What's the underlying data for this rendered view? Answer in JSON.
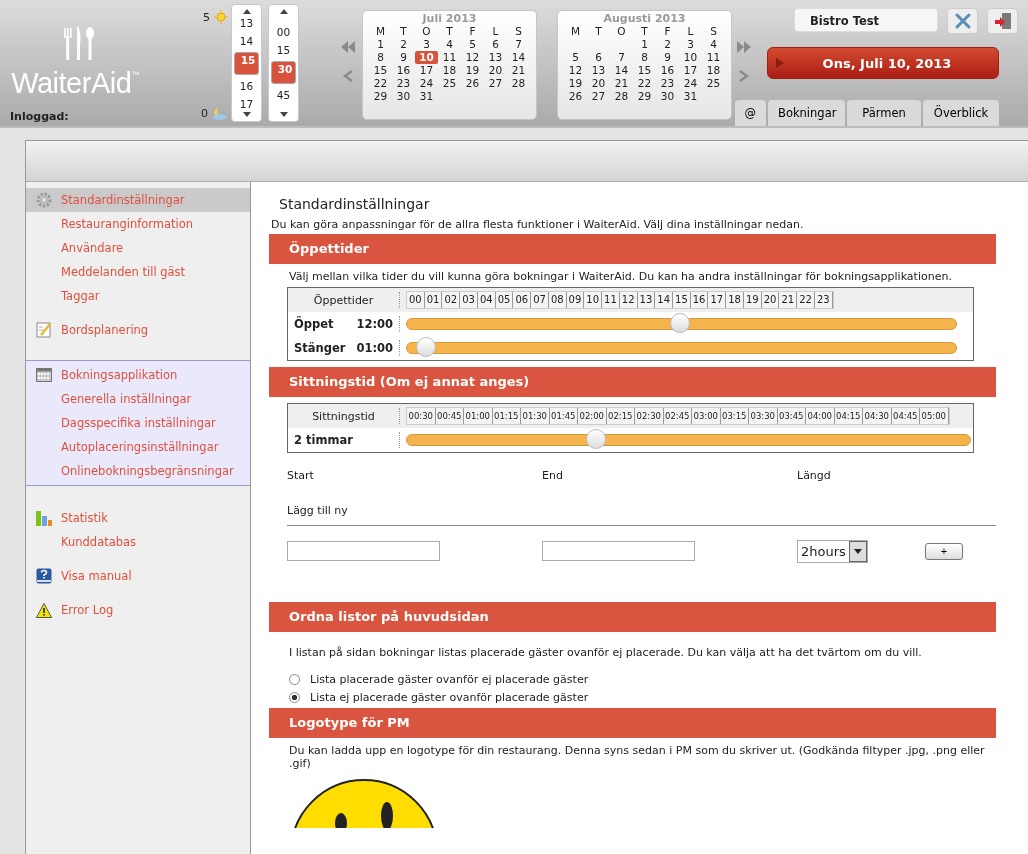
{
  "header": {
    "logo": "WaiterAid",
    "trademark": "™",
    "logged_in_label": "Inloggad:",
    "sun_count": "5",
    "moon_count": "0"
  },
  "hour_picker": [
    {
      "label": "13",
      "selected": false
    },
    {
      "label": "14",
      "selected": false
    },
    {
      "label": "15",
      "selected": true
    },
    {
      "label": "16",
      "selected": false
    },
    {
      "label": "17",
      "selected": false
    }
  ],
  "minute_picker": [
    {
      "label": "00",
      "selected": false
    },
    {
      "label": "15",
      "selected": false
    },
    {
      "label": "30",
      "selected": true
    },
    {
      "label": "45",
      "selected": false
    }
  ],
  "calendars": [
    {
      "title": "Juli 2013",
      "weekdays": [
        "M",
        "T",
        "O",
        "T",
        "F",
        "L",
        "S"
      ],
      "weeks": [
        [
          {
            "d": "1",
            "selected": false
          },
          {
            "d": "2",
            "selected": false
          },
          {
            "d": "3",
            "selected": false
          },
          {
            "d": "4",
            "selected": false
          },
          {
            "d": "5",
            "selected": false
          },
          {
            "d": "6",
            "selected": false
          },
          {
            "d": "7",
            "selected": false
          }
        ],
        [
          {
            "d": "8",
            "selected": false
          },
          {
            "d": "9",
            "selected": false
          },
          {
            "d": "10",
            "selected": true
          },
          {
            "d": "11",
            "selected": false
          },
          {
            "d": "12",
            "selected": false
          },
          {
            "d": "13",
            "selected": false
          },
          {
            "d": "14",
            "selected": false
          }
        ],
        [
          {
            "d": "15",
            "selected": false
          },
          {
            "d": "16",
            "selected": false
          },
          {
            "d": "17",
            "selected": false
          },
          {
            "d": "18",
            "selected": false
          },
          {
            "d": "19",
            "selected": false
          },
          {
            "d": "20",
            "selected": false
          },
          {
            "d": "21",
            "selected": false
          }
        ],
        [
          {
            "d": "22",
            "selected": false
          },
          {
            "d": "23",
            "selected": false
          },
          {
            "d": "24",
            "selected": false
          },
          {
            "d": "25",
            "selected": false
          },
          {
            "d": "26",
            "selected": false
          },
          {
            "d": "27",
            "selected": false
          },
          {
            "d": "28",
            "selected": false
          }
        ],
        [
          {
            "d": "29",
            "selected": false
          },
          {
            "d": "30",
            "selected": false
          },
          {
            "d": "31",
            "selected": false
          }
        ]
      ]
    },
    {
      "title": "Augusti 2013",
      "weekdays": [
        "M",
        "T",
        "O",
        "T",
        "F",
        "L",
        "S"
      ],
      "weeks": [
        [
          {
            "d": "1",
            "selected": false
          },
          {
            "d": "2",
            "selected": false
          },
          {
            "d": "3",
            "selected": false
          },
          {
            "d": "4",
            "selected": false
          }
        ],
        [
          {
            "d": "5",
            "selected": false
          },
          {
            "d": "6",
            "selected": false
          },
          {
            "d": "7",
            "selected": false
          },
          {
            "d": "8",
            "selected": false
          },
          {
            "d": "9",
            "selected": false
          },
          {
            "d": "10",
            "selected": false
          },
          {
            "d": "11",
            "selected": false
          }
        ],
        [
          {
            "d": "12",
            "selected": false
          },
          {
            "d": "13",
            "selected": false
          },
          {
            "d": "14",
            "selected": false
          },
          {
            "d": "15",
            "selected": false
          },
          {
            "d": "16",
            "selected": false
          },
          {
            "d": "17",
            "selected": false
          },
          {
            "d": "18",
            "selected": false
          }
        ],
        [
          {
            "d": "19",
            "selected": false
          },
          {
            "d": "20",
            "selected": false
          },
          {
            "d": "21",
            "selected": false
          },
          {
            "d": "22",
            "selected": false
          },
          {
            "d": "23",
            "selected": false
          },
          {
            "d": "24",
            "selected": false
          },
          {
            "d": "25",
            "selected": false
          }
        ],
        [
          {
            "d": "26",
            "selected": false
          },
          {
            "d": "27",
            "selected": false
          },
          {
            "d": "28",
            "selected": false
          },
          {
            "d": "29",
            "selected": false
          },
          {
            "d": "30",
            "selected": false
          },
          {
            "d": "31",
            "selected": false
          }
        ]
      ]
    }
  ],
  "restaurant_name": "Bistro Test",
  "date_button": "Ons, Juli 10, 2013",
  "tabs": [
    {
      "label": "@",
      "selected": false
    },
    {
      "label": "Bokningar",
      "selected": false
    },
    {
      "label": "Pärmen",
      "selected": false
    },
    {
      "label": "Överblick",
      "selected": false
    }
  ],
  "sidebar": [
    {
      "highlighted": false,
      "items": [
        {
          "kind": "settings",
          "label": "Standardinställningar",
          "selected": true
        },
        {
          "kind": "sub",
          "label": "Restauranginformation",
          "selected": false
        },
        {
          "kind": "sub",
          "label": "Användare",
          "selected": false
        },
        {
          "kind": "sub",
          "label": "Meddelanden till gäst",
          "selected": false
        },
        {
          "kind": "sub",
          "label": "Taggar",
          "selected": false
        },
        {
          "kind": "planning",
          "label": "Bordsplanering",
          "selected": false
        }
      ]
    },
    {
      "highlighted": true,
      "items": [
        {
          "kind": "booking",
          "label": "Bokningsapplikation",
          "selected": false
        },
        {
          "kind": "sub",
          "label": "Generella inställningar",
          "selected": false
        },
        {
          "kind": "sub",
          "label": "Dagsspecifika inställningar",
          "selected": false
        },
        {
          "kind": "sub",
          "label": "Autoplaceringsinställningar",
          "selected": false
        },
        {
          "kind": "sub",
          "label": "Onlinebokningsbegränsningar",
          "selected": false
        }
      ]
    },
    {
      "highlighted": false,
      "items": [
        {
          "kind": "statistics",
          "label": "Statistik",
          "selected": false
        },
        {
          "kind": "sub",
          "label": "Kunddatabas",
          "selected": false
        },
        {
          "kind": "help",
          "label": "Visa manual",
          "selected": false
        },
        {
          "kind": "error",
          "label": "Error Log",
          "selected": false
        }
      ]
    }
  ],
  "page_title": "Standardinställningar",
  "intro": "Du kan göra anpassningar för de allra flesta funktioner i WaiterAid. Välj dina inställningar nedan.",
  "opening_hours": {
    "heading": "Öppettider",
    "description": "Välj mellan vilka tider du vill kunna göra bokningar i WaiterAid. Du kan ha andra inställningar för bokningsapplikationen.",
    "table_label": "Öppettider",
    "ticks": [
      "00",
      "01",
      "02",
      "03",
      "04",
      "05",
      "06",
      "07",
      "08",
      "09",
      "10",
      "11",
      "12",
      "13",
      "14",
      "15",
      "16",
      "17",
      "18",
      "19",
      "20",
      "21",
      "22",
      "23"
    ],
    "rows": [
      {
        "label": "Öppet",
        "value": "12:00",
        "level": 0.5
      },
      {
        "label": "Stänger",
        "value": "01:00",
        "level": 0.04
      }
    ]
  },
  "seating_time": {
    "heading": "Sittningstid (Om ej annat anges)",
    "table_label": "Sittningstid",
    "ticks": [
      "00:30",
      "00:45",
      "01:00",
      "01:15",
      "01:30",
      "01:45",
      "02:00",
      "02:15",
      "02:30",
      "02:45",
      "03:00",
      "03:15",
      "03:30",
      "03:45",
      "04:00",
      "04:15",
      "04:30",
      "04:45",
      "05:00"
    ],
    "rows": [
      {
        "label": "2 timmar",
        "level": 0.34
      }
    ],
    "columns": [
      "Start",
      "End",
      "Längd"
    ],
    "add_label": "Lägg till ny",
    "length_value": "2hours",
    "add_button": "+"
  },
  "list_order": {
    "heading": "Ordna listor på huvudsidan",
    "description": "I listan på sidan bokningar listas placerade gäster ovanför ej placerade. Du kan välja att ha det tvärtom om du vill.",
    "options": [
      {
        "label": "Lista placerade gäster ovanför ej placerade gäster",
        "selected": false
      },
      {
        "label": "Lista ej placerade gäster ovanför placerade gäster",
        "selected": true
      }
    ]
  },
  "logo_section": {
    "heading": "Logotype för PM",
    "description": "Du kan ladda upp en logotype för din restaurang. Denna syns sedan i PM som du skriver ut. (Godkända filtyper .jpg, .png eller .gif)"
  }
}
